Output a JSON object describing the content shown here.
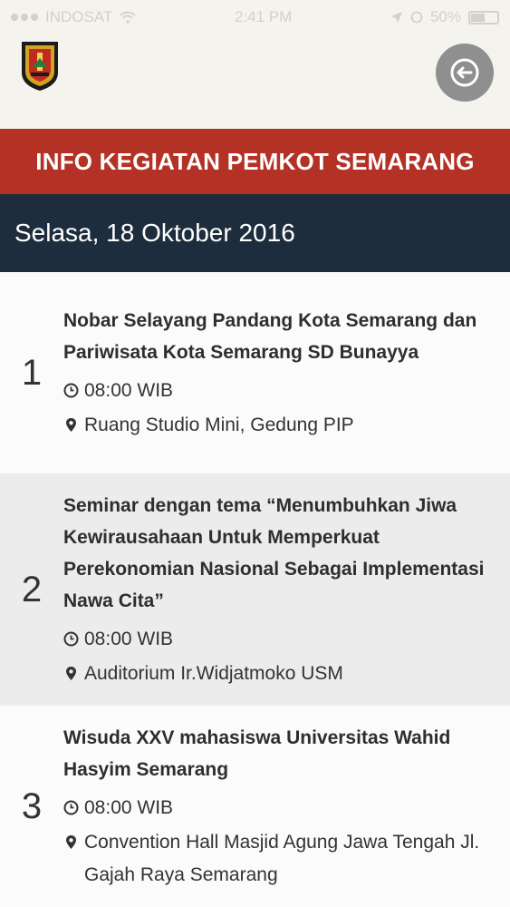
{
  "status_bar": {
    "carrier": "INDOSAT",
    "time": "2:41 PM",
    "battery": "50%"
  },
  "header": {
    "logo_icon": "semarang-crest-icon",
    "back_icon": "back-arrow-icon"
  },
  "title_bar": {
    "text": "INFO KEGIATAN PEMKOT SEMARANG"
  },
  "date_bar": {
    "text": "Selasa, 18 Oktober 2016"
  },
  "events": [
    {
      "number": "1",
      "title": "Nobar Selayang Pandang Kota Semarang dan Pariwisata Kota Semarang SD Bunayya",
      "time": "08:00 WIB",
      "location": "Ruang Studio Mini, Gedung PIP"
    },
    {
      "number": "2",
      "title": "Seminar dengan tema “Menumbuhkan Jiwa Kewirausahaan Untuk Memperkuat Perekonomian Nasional Sebagai Implementasi Nawa Cita”",
      "time": "08:00 WIB",
      "location": "Auditorium Ir.Widjatmoko USM"
    },
    {
      "number": "3",
      "title": "Wisuda XXV mahasiswa Universitas Wahid Hasyim Semarang",
      "time": "08:00 WIB",
      "location": "Convention Hall Masjid Agung Jawa Tengah Jl. Gajah Raya Semarang"
    }
  ],
  "colors": {
    "title_bar": "#b43126",
    "date_bar": "#1e2d3d",
    "back_button": "#8f8f8f"
  }
}
